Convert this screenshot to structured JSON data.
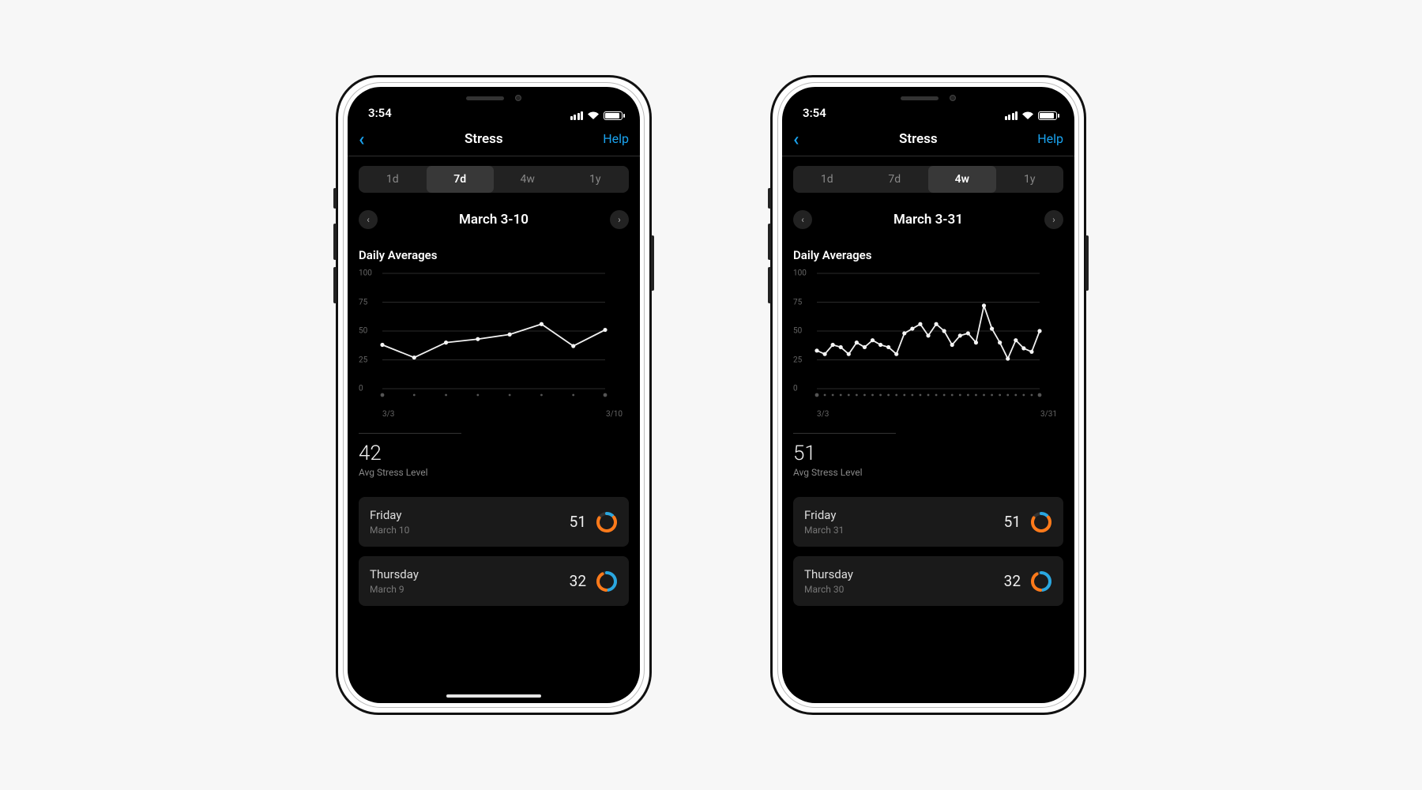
{
  "status_time": "3:54",
  "nav": {
    "title": "Stress",
    "help": "Help"
  },
  "segments": [
    "1d",
    "7d",
    "4w",
    "1y"
  ],
  "avg_caption": "Avg Stress Level",
  "yticks": [
    0,
    25,
    50,
    75,
    100
  ],
  "phones": [
    {
      "active_segment": "7d",
      "range_label": "March 3-10",
      "section_title": "Daily Averages",
      "x_start": "3/3",
      "x_end": "3/10",
      "avg_value": "42",
      "days": [
        {
          "weekday": "Friday",
          "date": "March 10",
          "value": "51",
          "ring": "orange"
        },
        {
          "weekday": "Thursday",
          "date": "March 9",
          "value": "32",
          "ring": "blue"
        }
      ]
    },
    {
      "active_segment": "4w",
      "range_label": "March 3-31",
      "section_title": "Daily Averages",
      "x_start": "3/3",
      "x_end": "3/31",
      "avg_value": "51",
      "days": [
        {
          "weekday": "Friday",
          "date": "March 31",
          "value": "51",
          "ring": "orange"
        },
        {
          "weekday": "Thursday",
          "date": "March 30",
          "value": "32",
          "ring": "blue"
        }
      ]
    }
  ],
  "chart_data": [
    {
      "type": "line",
      "title": "Daily Averages",
      "xlabel": "",
      "ylabel": "",
      "ylim": [
        0,
        100
      ],
      "yticks": [
        0,
        25,
        50,
        75,
        100
      ],
      "x": [
        "3/3",
        "3/4",
        "3/5",
        "3/6",
        "3/7",
        "3/8",
        "3/9",
        "3/10"
      ],
      "series": [
        {
          "name": "Stress",
          "values": [
            38,
            27,
            40,
            43,
            47,
            56,
            37,
            51
          ]
        }
      ]
    },
    {
      "type": "line",
      "title": "Daily Averages",
      "xlabel": "",
      "ylabel": "",
      "ylim": [
        0,
        100
      ],
      "yticks": [
        0,
        25,
        50,
        75,
        100
      ],
      "x": [
        "3/3",
        "3/4",
        "3/5",
        "3/6",
        "3/7",
        "3/8",
        "3/9",
        "3/10",
        "3/11",
        "3/12",
        "3/13",
        "3/14",
        "3/15",
        "3/16",
        "3/17",
        "3/18",
        "3/19",
        "3/20",
        "3/21",
        "3/22",
        "3/23",
        "3/24",
        "3/25",
        "3/26",
        "3/27",
        "3/28",
        "3/29",
        "3/30",
        "3/31"
      ],
      "series": [
        {
          "name": "Stress",
          "values": [
            33,
            30,
            38,
            36,
            30,
            40,
            36,
            42,
            38,
            36,
            30,
            48,
            52,
            56,
            46,
            56,
            50,
            38,
            46,
            48,
            40,
            72,
            52,
            40,
            26,
            42,
            35,
            32,
            50
          ]
        }
      ]
    }
  ]
}
